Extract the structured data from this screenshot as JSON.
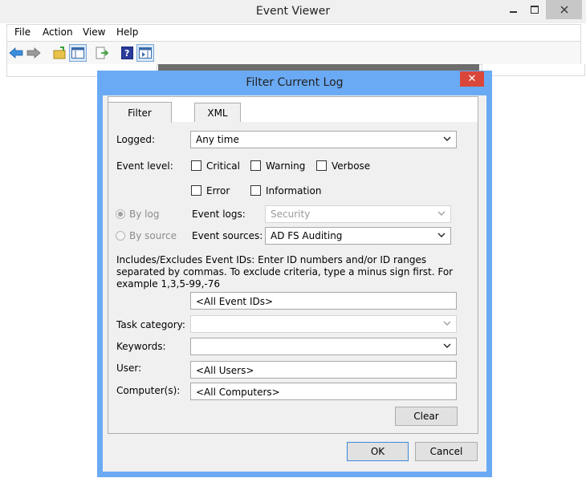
{
  "main_window": {
    "title": "Event Viewer",
    "menu": [
      "File",
      "Action",
      "View",
      "Help"
    ],
    "toolbar_icons": [
      "back-icon",
      "forward-icon",
      "open-folder-icon",
      "console-tree-icon",
      "export-icon",
      "help-icon",
      "action-pane-icon"
    ]
  },
  "dialog": {
    "title": "Filter Current Log",
    "close_glyph": "✕",
    "tabs": [
      "Filter",
      "XML"
    ],
    "logged_label": "Logged:",
    "logged_value": "Any time",
    "event_level_label": "Event level:",
    "levels": {
      "critical": "Critical",
      "warning": "Warning",
      "verbose": "Verbose",
      "error": "Error",
      "information": "Information"
    },
    "by_log_label": "By log",
    "by_source_label": "By source",
    "event_logs_label": "Event logs:",
    "event_logs_value": "Security",
    "event_sources_label": "Event sources:",
    "event_sources_value": "AD FS Auditing",
    "description": "Includes/Excludes Event IDs: Enter ID numbers and/or ID ranges separated by commas. To exclude criteria, type a minus sign first. For example 1,3,5-99,-76",
    "event_ids_value": "<All Event IDs>",
    "task_category_label": "Task category:",
    "task_category_value": "",
    "keywords_label": "Keywords:",
    "keywords_value": "",
    "user_label": "User:",
    "user_value": "<All Users>",
    "computer_label": "Computer(s):",
    "computer_value": "<All Computers>",
    "clear_button": "Clear",
    "ok_button": "OK",
    "cancel_button": "Cancel"
  },
  "colors": {
    "dialog_frame": "#6aaaf4",
    "close_button": "#d9473a",
    "window_bg": "#f0f0f0"
  }
}
